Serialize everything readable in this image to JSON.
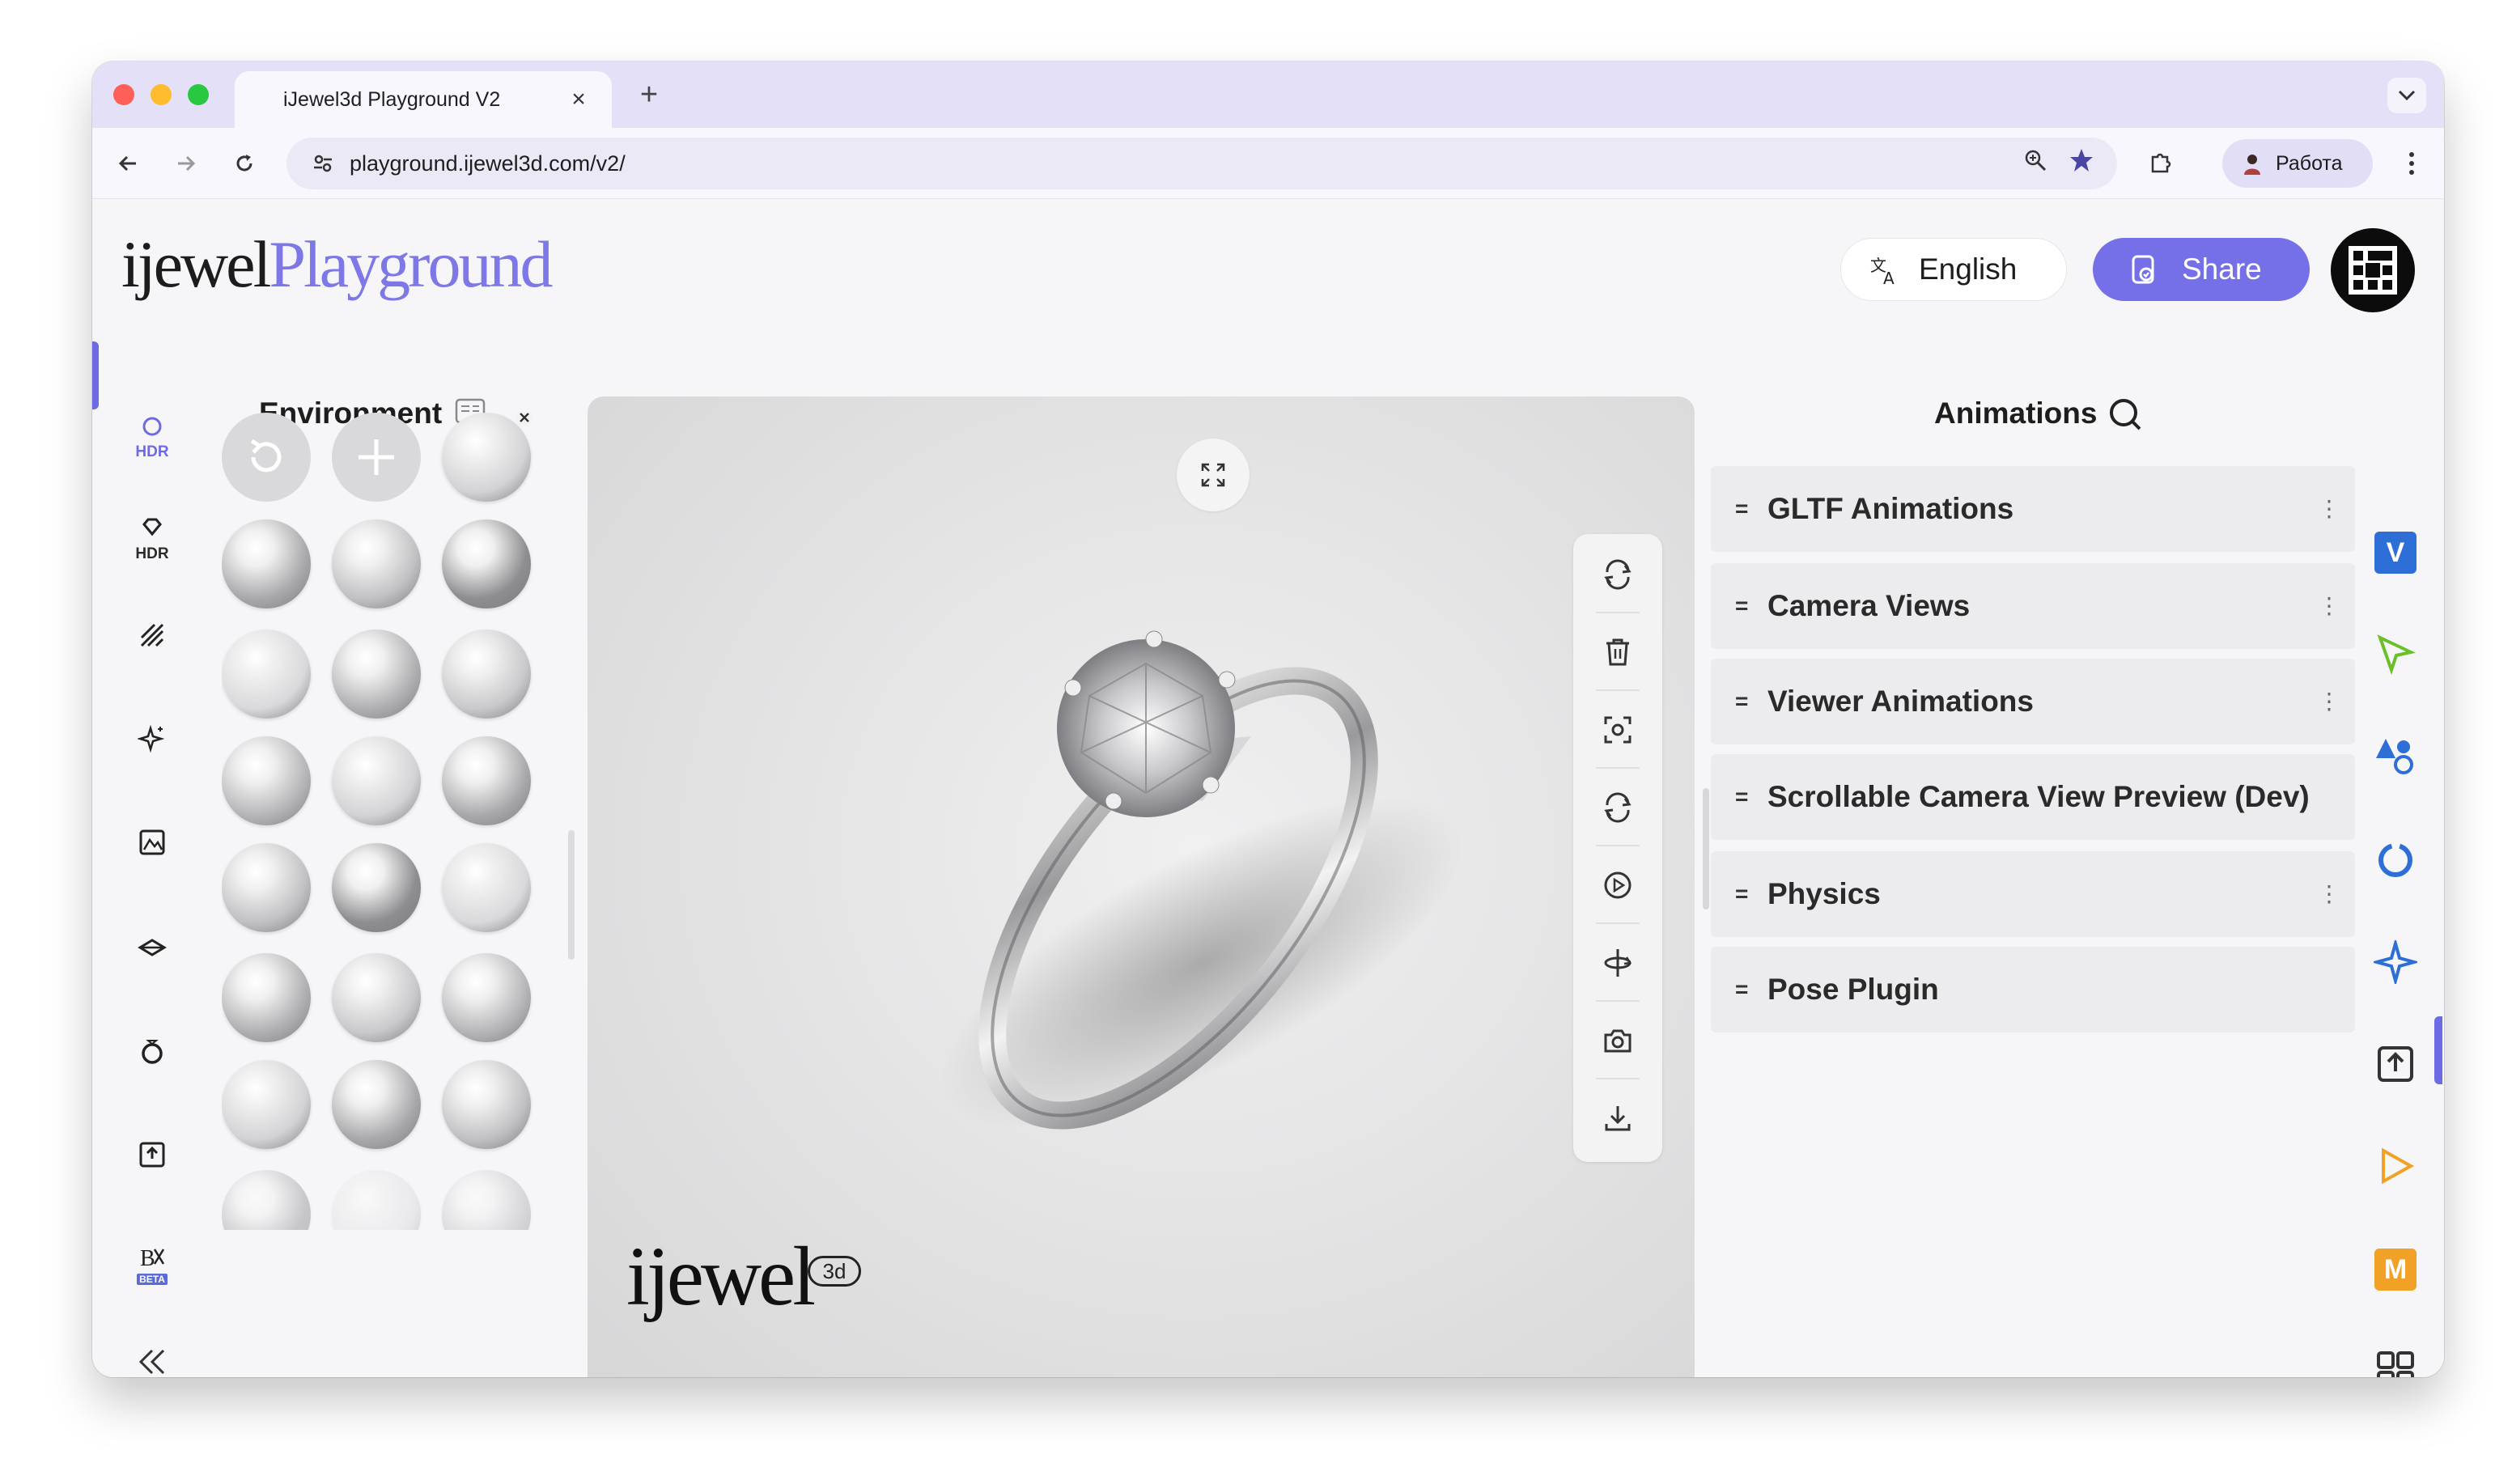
{
  "browser": {
    "tab_title": "iJewel3d Playground V2",
    "tab_close": "×",
    "new_tab": "+",
    "url": "playground.ijewel3d.com/v2/",
    "profile_label": "Работа"
  },
  "header": {
    "logo_primary": "ijewel",
    "logo_secondary": "Playground",
    "language_label": "English",
    "share_label": "Share"
  },
  "left_rail": {
    "items": [
      {
        "caption": "HDR",
        "icon": "hdr-circle-icon",
        "active": true
      },
      {
        "caption": "HDR",
        "icon": "diamond-hdr-icon"
      },
      {
        "caption": "",
        "icon": "hatch-lines-icon"
      },
      {
        "caption": "",
        "icon": "sparkle-icon"
      },
      {
        "caption": "",
        "icon": "image-frame-icon"
      },
      {
        "caption": "",
        "icon": "ground-plane-icon"
      },
      {
        "caption": "",
        "icon": "ring-icon"
      },
      {
        "caption": "",
        "icon": "upload-icon"
      },
      {
        "caption": "BETA",
        "icon": "bk-icon"
      }
    ],
    "collapse_label": "«"
  },
  "environment": {
    "title": "Environment"
  },
  "animations": {
    "title": "Animations",
    "rows": [
      {
        "label": "GLTF Animations",
        "more": "⋮"
      },
      {
        "label": "Camera Views",
        "more": "⋮"
      },
      {
        "label": "Viewer Animations",
        "more": "⋮"
      },
      {
        "label": "Scrollable Camera View Preview (Dev)",
        "more": ""
      },
      {
        "label": "Physics",
        "more": "⋮"
      },
      {
        "label": "Pose Plugin",
        "more": ""
      }
    ],
    "drag_glyph": "="
  },
  "viewport": {
    "watermark": "ijewel",
    "watermark_badge": "3d"
  },
  "right_rail": {
    "items": [
      {
        "icon": "v-badge-icon",
        "text": "V",
        "color": "#2d6fd6"
      },
      {
        "icon": "cursor-icon",
        "color": "#6bbf2b"
      },
      {
        "icon": "shapes-icon",
        "color": "#2d6fd6"
      },
      {
        "icon": "ring-outline-icon",
        "color": "#2d6fd6"
      },
      {
        "icon": "star-sparkle-icon",
        "color": "#2d6fd6"
      },
      {
        "icon": "upload-box-icon",
        "color": "#333333"
      },
      {
        "icon": "play-icon",
        "color": "#f0a126"
      },
      {
        "icon": "m-badge-icon",
        "text": "M",
        "color": "#f0a126"
      },
      {
        "icon": "grid-icon",
        "color": "#333333"
      },
      {
        "icon": "puzzle-icon",
        "color": "#333333"
      }
    ]
  },
  "colors": {
    "accent": "#7670e8",
    "tabstrip": "#e3e0f7"
  }
}
